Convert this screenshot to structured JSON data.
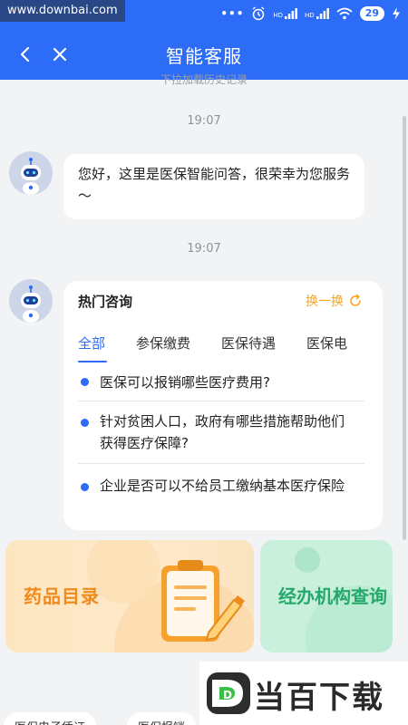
{
  "status_bar": {
    "watermark": "www.downbai.com",
    "dots": "•••",
    "signal1_label": "HD",
    "signal2_label": "HD",
    "battery": "29"
  },
  "nav": {
    "title": "智能客服"
  },
  "history_hint": "下拉加载历史记录",
  "messages": [
    {
      "time": "19:07",
      "text": "您好，这里是医保智能问答，很荣幸为您服务～"
    },
    {
      "time": "19:07"
    }
  ],
  "hot_card": {
    "title": "热门咨询",
    "refresh_label": "换一换",
    "tabs": [
      "全部",
      "参保缴费",
      "医保待遇",
      "医保电"
    ],
    "questions": [
      "医保可以报销哪些医疗费用?",
      "针对贫困人口，政府有哪些措施帮助他们获得医疗保障?",
      "企业是否可以不给员工缴纳基本医疗保险"
    ]
  },
  "tiles": [
    {
      "label": "药品目录"
    },
    {
      "label": "经办机构查询"
    }
  ],
  "bottom_pills": [
    "医保电子凭证",
    "医保报销"
  ],
  "brand": {
    "text": "当百下载",
    "logo_letter": "D"
  },
  "colors": {
    "primary": "#2c6cf6",
    "accent_orange": "#f5a623",
    "tile_orange": "#f08a1a",
    "tile_green": "#25a86b",
    "background": "#f2f3f5"
  }
}
